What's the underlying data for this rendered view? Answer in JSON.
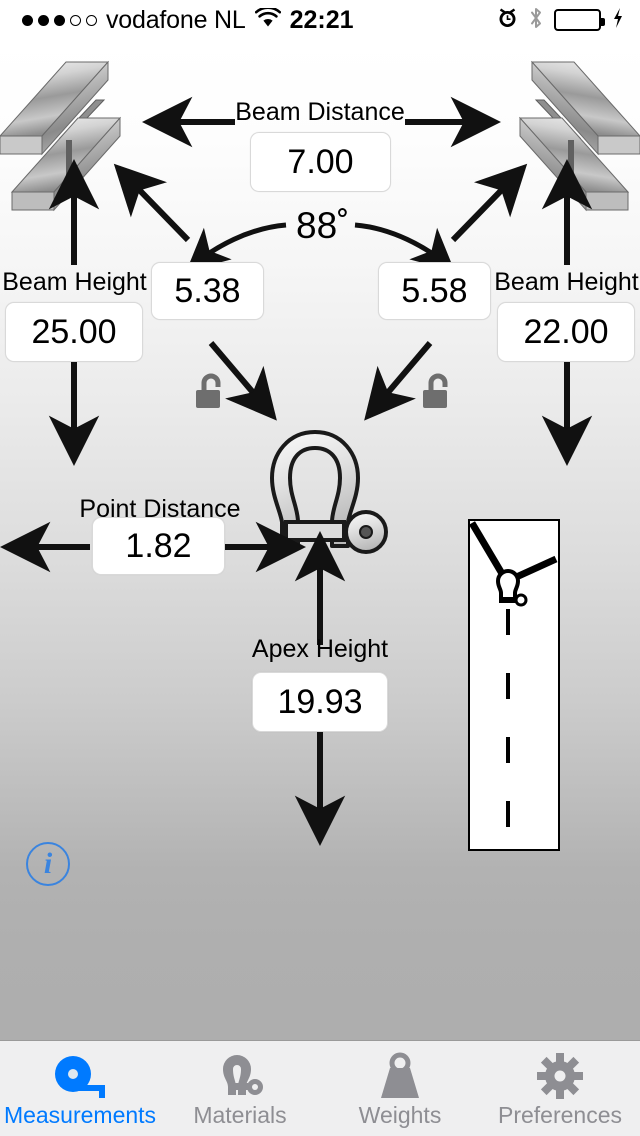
{
  "status_bar": {
    "signal_dots": [
      "on",
      "on",
      "on",
      "off",
      "off"
    ],
    "carrier": "vodafone NL",
    "wifi_icon": "wifi-icon",
    "time": "22:21",
    "alarm_icon": "alarm-clock-icon",
    "bluetooth_icon": "bluetooth-icon",
    "battery_icon": "battery-charging-icon",
    "battery_color": "#4cd964"
  },
  "measurements": {
    "beam_distance": {
      "label": "Beam Distance",
      "value": "7.00"
    },
    "beam_height_left": {
      "label": "Beam Height",
      "value": "25.00"
    },
    "beam_height_right": {
      "label": "Beam Height",
      "value": "22.00"
    },
    "sling_left": {
      "value": "5.38"
    },
    "sling_right": {
      "value": "5.58"
    },
    "angle": {
      "value": "88˚"
    },
    "point_distance": {
      "label": "Point Distance",
      "value": "1.82"
    },
    "apex_height": {
      "label": "Apex Height",
      "value": "19.93"
    }
  },
  "icons": {
    "beam_left": "i-beam-icon",
    "beam_right": "i-beam-icon",
    "shackle": "shackle-icon",
    "lock_left": "unlocked-padlock-icon",
    "lock_right": "unlocked-padlock-icon",
    "info": "info-icon",
    "info_glyph": "i"
  },
  "diagram_panel": {
    "name": "sling-angle-diagram",
    "shackle_icon": "shackle-icon",
    "plumb_line": "dashed-vertical-line"
  },
  "tab_bar": {
    "active_color": "#007aff",
    "inactive_color": "#8e8e93",
    "tabs": [
      {
        "label": "Measurements",
        "icon": "tape-measure-icon",
        "active": true
      },
      {
        "label": "Materials",
        "icon": "shackle-icon",
        "active": false
      },
      {
        "label": "Weights",
        "icon": "weight-icon",
        "active": false
      },
      {
        "label": "Preferences",
        "icon": "gear-icon",
        "active": false
      }
    ]
  }
}
